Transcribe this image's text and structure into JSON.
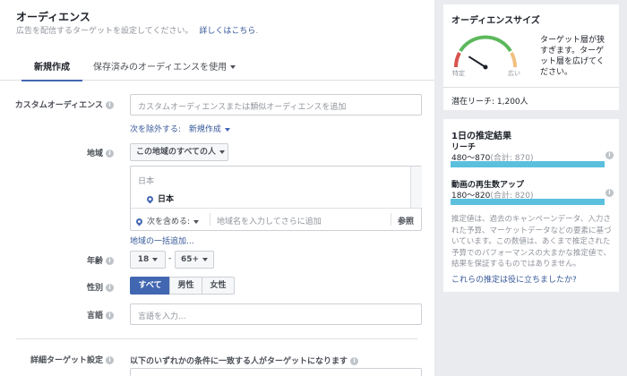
{
  "header": {
    "title": "オーディエンス",
    "subtitle": "広告を配信するターゲットを設定してください。",
    "learn_more": "詳しくはこちら",
    "period": "."
  },
  "tabs": [
    {
      "label": "新規作成"
    },
    {
      "label": "保存済みのオーディエンスを使用"
    }
  ],
  "custom_audience": {
    "label": "カスタムオーディエンス",
    "placeholder": "カスタムオーディエンスまたは類似オーディエンスを追加",
    "exclude_link": "次を除外する:",
    "create_new": "新規作成"
  },
  "location": {
    "label": "地域",
    "dropdown": "この地域のすべての人",
    "country_header": "日本",
    "selected_item": "日本",
    "include_dropdown": "次を含める:",
    "search_placeholder": "地域名を入力してさらに追加",
    "browse": "参照",
    "bulk_add": "地域の一括追加..."
  },
  "age": {
    "label": "年齢",
    "min": "18",
    "max": "65+",
    "separator": "-"
  },
  "gender": {
    "label": "性別",
    "options": [
      "すべて",
      "男性",
      "女性"
    ],
    "selected": "すべて"
  },
  "language": {
    "label": "言語",
    "placeholder": "言語を入力..."
  },
  "detailed": {
    "label": "詳細ターゲット設定",
    "description": "以下のいずれかの条件に一致する人がターゲットになります"
  },
  "audience_size": {
    "title": "オーディエンスサイズ",
    "gauge_min": "特定",
    "gauge_max": "広い",
    "gauge_level": 0.18,
    "message": "ターゲット層が狭すぎます。ターゲット層を広げてください。",
    "potential_reach": "潜在リーチ: 1,200人"
  },
  "daily_results": {
    "title": "1日の推定結果",
    "reach_label": "リーチ",
    "reach_value": "480〜870",
    "reach_total": "(合計: 870)",
    "video_label": "動画の再生数アップ",
    "video_value": "180〜820",
    "video_total": "(合計: 820)",
    "disclaimer": "推定値は、過去のキャンペーンデータ、入力された予算、マーケットデータなどの要素に基づいています。この数値は、あくまで推定された予算でのパフォーマンスの大まかな推定値で、結果を保証するものではありません。",
    "feedback_link": "これらの推定は役に立ちましたか?"
  },
  "colors": {
    "accent": "#4267b2",
    "bar": "#5bc0de",
    "gauge_red": "#d9534f",
    "gauge_green": "#5cb85c",
    "gauge_orange": "#f0c080"
  }
}
